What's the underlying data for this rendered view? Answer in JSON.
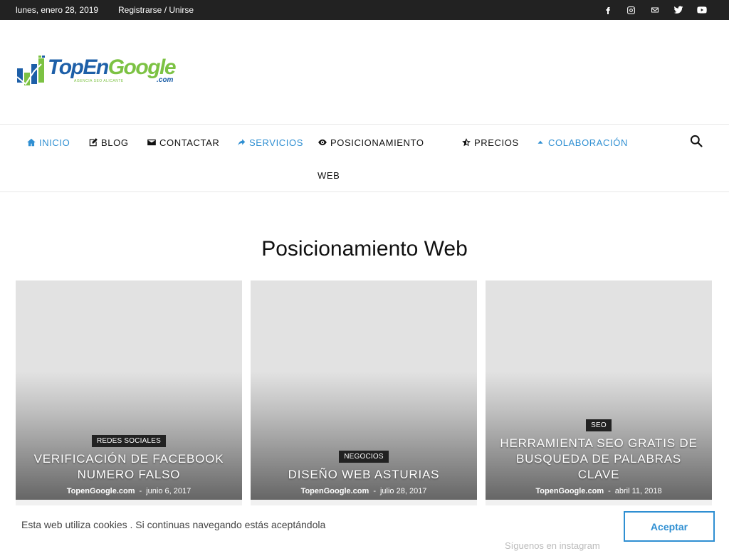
{
  "topbar": {
    "date": "lunes, enero 28, 2019",
    "login": "Registrarse / Unirse",
    "social": [
      "facebook-icon",
      "instagram-icon",
      "mail-icon",
      "twitter-icon",
      "youtube-icon"
    ]
  },
  "logo": {
    "word_part1": "TopEn",
    "word_part2": "Google",
    "dotcom": ".com",
    "tagline": "AGENCIA SEO ALICANTE"
  },
  "nav": {
    "items": [
      {
        "label": "INICIO",
        "icon": "home-icon",
        "active": true
      },
      {
        "label": "BLOG",
        "icon": "edit-icon",
        "active": false
      },
      {
        "label": "CONTACTAR",
        "icon": "mail-icon",
        "active": false
      },
      {
        "label": "SERVICIOS",
        "icon": "share-arrow-icon",
        "active": true
      },
      {
        "label": "POSICIONAMIENTO",
        "icon": "eye-icon",
        "active": false
      },
      {
        "label": "PRECIOS",
        "icon": "star-half-icon",
        "active": false
      },
      {
        "label": "COLABORACIÓN",
        "icon": "caret-up-icon",
        "active": true
      }
    ],
    "wrap_text": "WEB",
    "search_icon": "search-icon"
  },
  "page": {
    "title": "Posicionamiento Web"
  },
  "cards": [
    {
      "category": "REDES SOCIALES",
      "title": "VERIFICACIÓN DE FACEBOOK NUMERO FALSO",
      "author": "TopenGoogle.com",
      "separator": "-",
      "date": "junio 6, 2017"
    },
    {
      "category": "NEGOCIOS",
      "title": "DISEÑO WEB ASTURIAS",
      "author": "TopenGoogle.com",
      "separator": "-",
      "date": "julio 28, 2017"
    },
    {
      "category": "SEO",
      "title": "HERRAMIENTA SEO GRATIS DE BUSQUEDA DE PALABRAS CLAVE",
      "author": "TopenGoogle.com",
      "separator": "-",
      "date": "abril 11, 2018"
    }
  ],
  "cookie": {
    "message": "Esta web utiliza cookies . Si continuas navegando estás aceptándola",
    "accept_label": "Aceptar",
    "behind_text": "Síguenos en instagram"
  },
  "colors": {
    "accent": "#2f8fd2",
    "topbar": "#222222",
    "logo_blue": "#1d5fa8",
    "logo_green": "#7cc243"
  }
}
